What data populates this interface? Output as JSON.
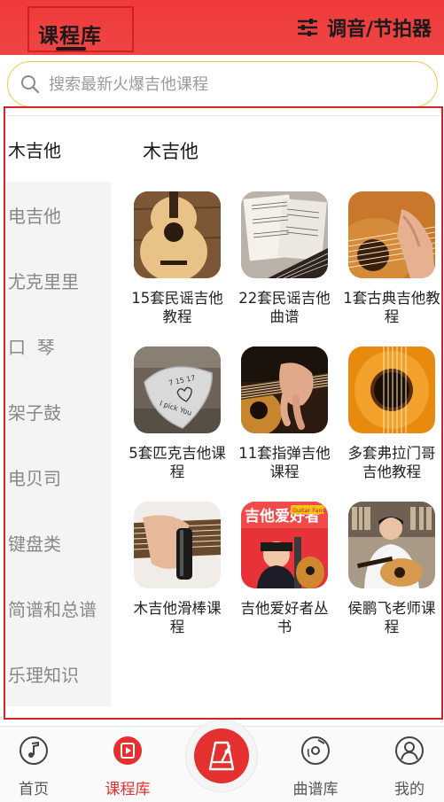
{
  "header": {
    "active_tab": "课程库",
    "tuner_link": "调音/节拍器"
  },
  "search": {
    "placeholder": "搜索最新火爆吉他课程"
  },
  "sidebar": {
    "items": [
      {
        "label": "木吉他",
        "active": true
      },
      {
        "label": "电吉他",
        "active": false
      },
      {
        "label": "尤克里里",
        "active": false
      },
      {
        "label": "口  琴",
        "active": false
      },
      {
        "label": "架子鼓",
        "active": false
      },
      {
        "label": "电贝司",
        "active": false
      },
      {
        "label": "键盘类",
        "active": false
      },
      {
        "label": "简谱和总谱",
        "active": false
      },
      {
        "label": "乐理知识",
        "active": false
      }
    ]
  },
  "main": {
    "title": "木吉他",
    "courses": [
      {
        "caption": "15套民谣吉他教程",
        "thumb": "acoustic-guitar-image"
      },
      {
        "caption": "22套民谣吉他曲谱",
        "thumb": "sheet-music-image"
      },
      {
        "caption": "1套古典吉他教程",
        "thumb": "classical-guitar-image"
      },
      {
        "caption": "5套匹克吉他课程",
        "thumb": "guitar-pick-image",
        "pick_text": "I pick You"
      },
      {
        "caption": "11套指弹吉他课程",
        "thumb": "fingerstyle-image"
      },
      {
        "caption": "多套弗拉门哥吉他教程",
        "thumb": "flamenco-guitar-image"
      },
      {
        "caption": "木吉他滑棒课程",
        "thumb": "slide-guitar-image"
      },
      {
        "caption": "吉他爱好者丛书",
        "thumb": "book-cover-image",
        "cover_title": "吉他爱好者",
        "cover_badge": "Guitar Fans"
      },
      {
        "caption": "侯鹏飞老师课程",
        "thumb": "teacher-photo-image"
      }
    ]
  },
  "bottom_nav": {
    "items": [
      {
        "label": "首页",
        "icon": "music-note-icon",
        "active": false
      },
      {
        "label": "课程库",
        "icon": "course-library-icon",
        "active": true
      },
      {
        "label": "",
        "icon": "metronome-icon",
        "active": false
      },
      {
        "label": "曲谱库",
        "icon": "music-disc-icon",
        "active": false
      },
      {
        "label": "我的",
        "icon": "user-icon",
        "active": false
      }
    ]
  },
  "colors": {
    "accent": "#e53030",
    "header_bg": "#ef4040",
    "search_border": "#f0c94a"
  }
}
